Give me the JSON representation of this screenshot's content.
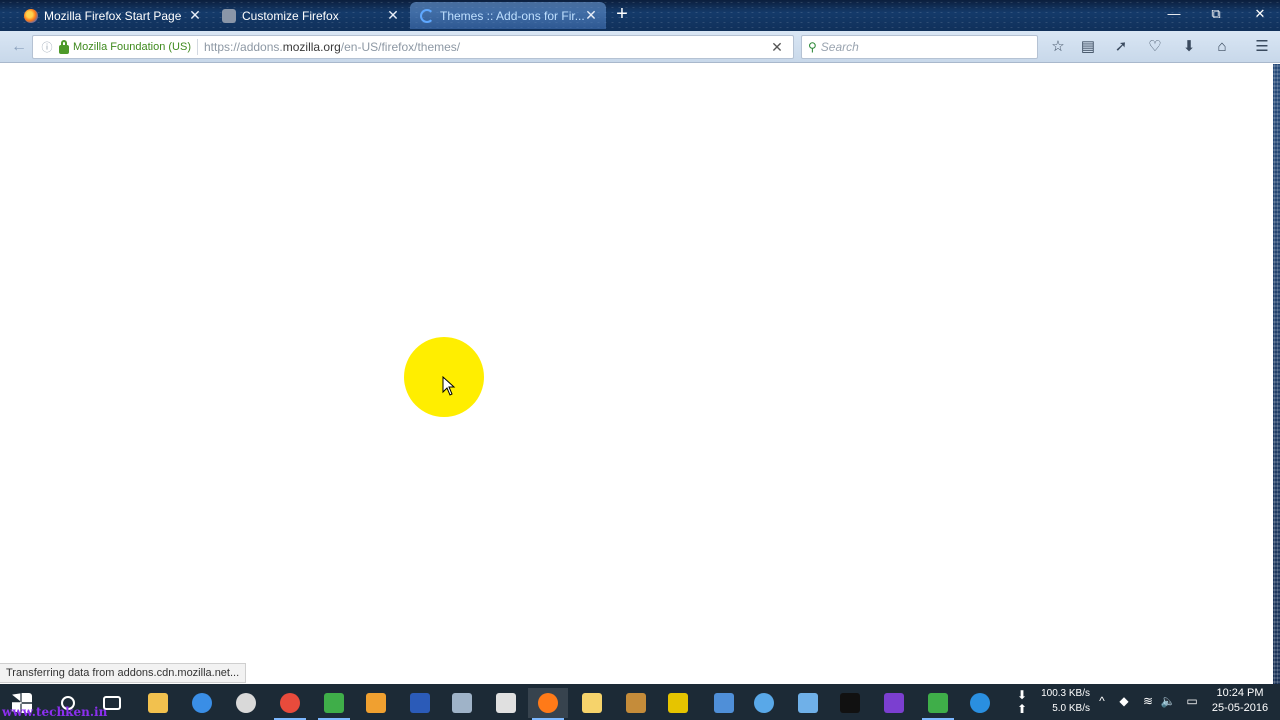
{
  "browser": {
    "tabs": [
      {
        "title": "Mozilla Firefox Start Page",
        "icon": "firefox-icon",
        "active": false
      },
      {
        "title": "Customize Firefox",
        "icon": "gear-icon",
        "active": false
      },
      {
        "title": "Themes :: Add-ons for Fir...",
        "icon": "loading-icon",
        "active": true
      }
    ],
    "window_controls": {
      "minimize": "—",
      "restore": "⧉",
      "close": "✕"
    }
  },
  "navbar": {
    "identity": "Mozilla Foundation (US)",
    "url_prefix": "https://addons.",
    "url_domain": "mozilla.org",
    "url_path": "/en-US/firefox/themes/",
    "search_placeholder": "Search"
  },
  "status": {
    "text": "Transferring data from addons.cdn.mozilla.net..."
  },
  "taskbar": {
    "watermark": "www.techken.in",
    "net_down": "100.3 KB/s",
    "net_up": "5.0 KB/s",
    "time": "10:24 PM",
    "date": "25-05-2016",
    "apps": [
      {
        "name": "start-button",
        "color": "#ffffff"
      },
      {
        "name": "search-taskbar",
        "color": "#ffffff"
      },
      {
        "name": "task-view",
        "color": "#ffffff"
      },
      {
        "name": "file-explorer",
        "color": "#f2c14e"
      },
      {
        "name": "edge",
        "color": "#3a8ee6"
      },
      {
        "name": "app-red",
        "color": "#d9d9d9"
      },
      {
        "name": "chrome",
        "color": "#e84b3c"
      },
      {
        "name": "app-green",
        "color": "#3fae49"
      },
      {
        "name": "app-orange",
        "color": "#f0a030"
      },
      {
        "name": "word",
        "color": "#2b5bb8"
      },
      {
        "name": "app-gray",
        "color": "#9fb3c8"
      },
      {
        "name": "calculator",
        "color": "#e0e0e0"
      },
      {
        "name": "firefox",
        "color": "#ff7a18"
      },
      {
        "name": "folder",
        "color": "#f6d36b"
      },
      {
        "name": "app-dark",
        "color": "#c58c3a"
      },
      {
        "name": "app-yellow",
        "color": "#e6c400"
      },
      {
        "name": "network-app",
        "color": "#4f8fd8"
      },
      {
        "name": "globe-app",
        "color": "#59a8e8"
      },
      {
        "name": "vs-app",
        "color": "#6fb0e8"
      },
      {
        "name": "cmd",
        "color": "#111111"
      },
      {
        "name": "app-purple",
        "color": "#7b3fd0"
      },
      {
        "name": "app-green2",
        "color": "#3fae49"
      },
      {
        "name": "ie",
        "color": "#2a8fe0"
      }
    ]
  }
}
